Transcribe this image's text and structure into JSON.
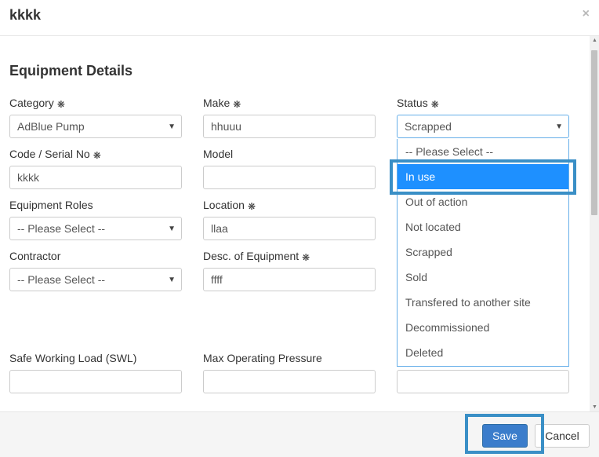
{
  "modal": {
    "title": "kkkk",
    "close_symbol": "×"
  },
  "section": {
    "title": "Equipment Details"
  },
  "required_symbol": "❋",
  "fields": {
    "category": {
      "label": "Category",
      "value": "AdBlue Pump"
    },
    "make": {
      "label": "Make",
      "value": "hhuuu"
    },
    "status": {
      "label": "Status",
      "value": "Scrapped"
    },
    "code": {
      "label": "Code / Serial No",
      "value": "kkkk"
    },
    "model": {
      "label": "Model",
      "value": ""
    },
    "roles": {
      "label": "Equipment Roles",
      "value": "-- Please Select --"
    },
    "location": {
      "label": "Location",
      "value": "llaa"
    },
    "contractor": {
      "label": "Contractor",
      "value": "-- Please Select --"
    },
    "desc": {
      "label": "Desc. of Equipment",
      "value": "ffff"
    },
    "swl": {
      "label": "Safe Working Load (SWL)",
      "value": ""
    },
    "pressure": {
      "label": "Max Operating Pressure",
      "value": ""
    }
  },
  "status_options": [
    "-- Please Select --",
    "In use",
    "Out of action",
    "Not located",
    "Scrapped",
    "Sold",
    "Transfered to another site",
    "Decommissioned",
    "Deleted"
  ],
  "status_highlighted": "In use",
  "footer": {
    "save_label": "Save",
    "cancel_label": "Cancel"
  },
  "colors": {
    "primary": "#3b7dcb",
    "highlight": "#1e90ff",
    "annotation": "#3a8fc6"
  }
}
